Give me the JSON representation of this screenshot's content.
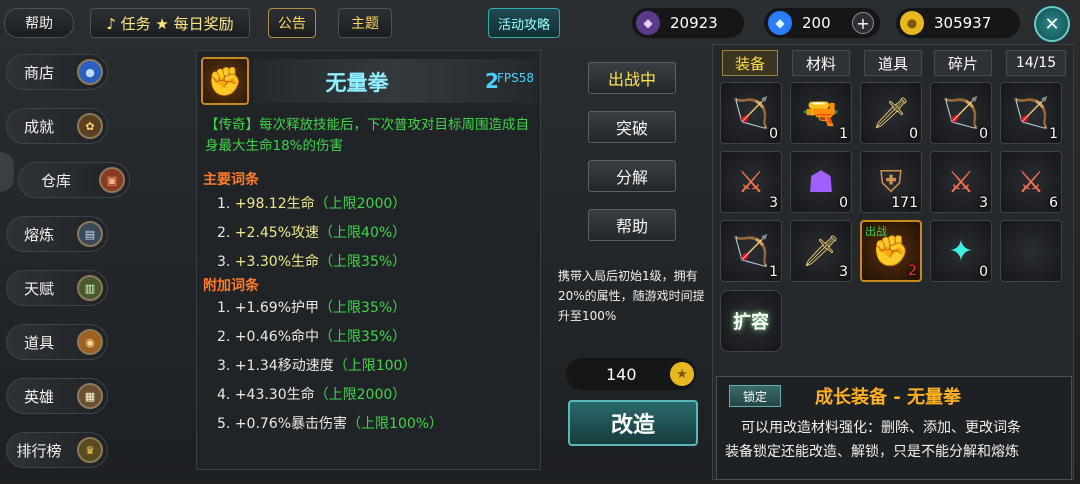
{
  "topbar": {
    "help": "帮助",
    "task": "♪ 任务 ★ 每日奖励",
    "notice": "公告",
    "theme": "主题",
    "guide": "活动攻略",
    "purple_currency": "20923",
    "gem_currency": "200",
    "gold_currency": "305937",
    "plus": "+",
    "close": "✕"
  },
  "sidebar": {
    "items": [
      {
        "label": "商店"
      },
      {
        "label": "成就"
      },
      {
        "label": "仓库"
      },
      {
        "label": "熔炼"
      },
      {
        "label": "天赋"
      },
      {
        "label": "道具"
      },
      {
        "label": "英雄"
      },
      {
        "label": "排行榜"
      }
    ]
  },
  "detail": {
    "name": "无量拳",
    "level": "2",
    "fps": "FPS58",
    "legend": "【传奇】每次释放技能后，下次普攻对目标周围造成自身最大生命18%的伤害",
    "main_header": "主要词条",
    "main_stats": [
      {
        "idx": "1.",
        "val": "+98.12生命",
        "lim": "（上限2000）"
      },
      {
        "idx": "2.",
        "val": "+2.45%攻速",
        "lim": "（上限40%）"
      },
      {
        "idx": "3.",
        "val": "+3.30%生命",
        "lim": "（上限35%）"
      }
    ],
    "extra_header": "附加词条",
    "extra_stats": [
      {
        "idx": "1.",
        "val": "+1.69%护甲",
        "lim": "（上限35%）"
      },
      {
        "idx": "2.",
        "val": "+0.46%命中",
        "lim": "（上限35%）"
      },
      {
        "idx": "3.",
        "val": "+1.34移动速度",
        "lim": "（上限100）"
      },
      {
        "idx": "4.",
        "val": "+43.30生命",
        "lim": "（上限2000）"
      },
      {
        "idx": "5.",
        "val": "+0.76%暴击伤害",
        "lim": "（上限100%）"
      }
    ]
  },
  "actions": {
    "deploy": "出战中",
    "breakthrough": "突破",
    "decompose": "分解",
    "help": "帮助",
    "note": "携带入局后初始1级，拥有20%的属性，随游戏时间提升至100%",
    "cost": "140",
    "reforge": "改造"
  },
  "inventory": {
    "tabs": [
      "装备",
      "材料",
      "道具",
      "碎片"
    ],
    "capacity": "14/15",
    "slots": [
      {
        "icon": "crossbow-icon",
        "count": "0",
        "glyph": "🏹",
        "color": "#c9a6ff"
      },
      {
        "icon": "blaster-icon",
        "count": "1",
        "glyph": "🔫",
        "color": "#4da6ff"
      },
      {
        "icon": "blade-icon",
        "count": "0",
        "glyph": "🗡",
        "color": "#e0c070"
      },
      {
        "icon": "bow-icon",
        "count": "0",
        "glyph": "🏹",
        "color": "#6fd0ff"
      },
      {
        "icon": "bow-icon",
        "count": "1",
        "glyph": "🏹",
        "color": "#6fd0ff"
      },
      {
        "icon": "red-sword-icon",
        "count": "3",
        "glyph": "⚔",
        "color": "#ff7050"
      },
      {
        "icon": "hooded-figure-icon",
        "count": "0",
        "glyph": "☗",
        "color": "#a060ff"
      },
      {
        "icon": "armor-icon",
        "count": "171",
        "glyph": "⛨",
        "color": "#d09050"
      },
      {
        "icon": "red-sword-icon",
        "count": "3",
        "glyph": "⚔",
        "color": "#ff7050"
      },
      {
        "icon": "red-sword-icon",
        "count": "6",
        "glyph": "⚔",
        "color": "#ff7050"
      },
      {
        "icon": "crossbow-icon",
        "count": "1",
        "glyph": "🏹",
        "color": "#c9a6ff"
      },
      {
        "icon": "blade-icon",
        "count": "3",
        "glyph": "🗡",
        "color": "#e0c070"
      },
      {
        "icon": "gauntlet-icon",
        "count": "2",
        "glyph": "✊",
        "color": "#ffb020",
        "tag": "出战"
      },
      {
        "icon": "orb-icon",
        "count": "0",
        "glyph": "✦",
        "color": "#40f0e0"
      },
      {
        "icon": "empty-slot",
        "count": "",
        "glyph": "",
        "color": "#444"
      }
    ],
    "expand": "扩容",
    "lock": "锁定",
    "title": "成长装备 - 无量拳",
    "desc1": "可以用改造材料强化：删除、添加、更改词条",
    "desc2": "装备锁定还能改造、解锁，只是不能分解和熔炼"
  },
  "colors": {
    "accent_gold": "#f5c542",
    "stat_limit": "#3fd44a",
    "header_orange": "#ff7a2a",
    "legend_green": "#3fd44a"
  }
}
